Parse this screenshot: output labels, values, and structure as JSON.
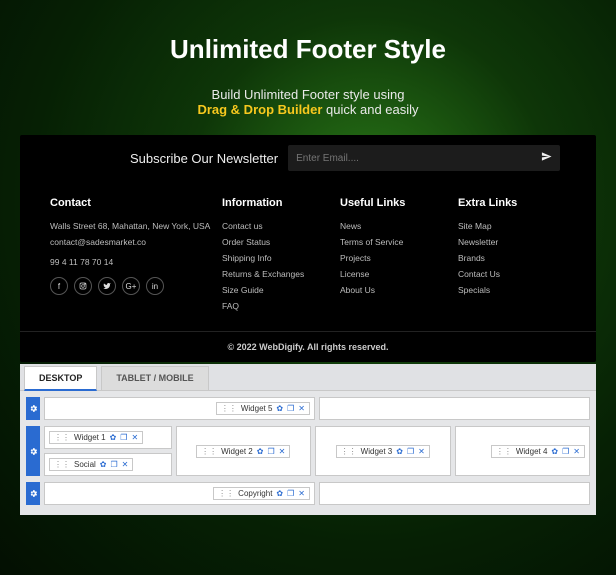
{
  "hero": {
    "title": "Unlimited Footer Style",
    "sub_before": "Build Unlimited Footer style using",
    "sub_accent": "Drag & Drop Builder",
    "sub_after": "quick and easily"
  },
  "newsletter": {
    "label": "Subscribe Our Newsletter",
    "placeholder": "Enter Email...."
  },
  "footer": {
    "contact": {
      "title": "Contact",
      "address": "Walls Street 68, Mahattan, New York, USA",
      "email": "contact@sadesmarket.co",
      "phone": "99 4 11 78 70 14"
    },
    "info": {
      "title": "Information",
      "items": [
        "Contact us",
        "Order Status",
        "Shipping Info",
        "Returns & Exchanges",
        "Size Guide",
        "FAQ"
      ]
    },
    "useful": {
      "title": "Useful Links",
      "items": [
        "News",
        "Terms of Service",
        "Projects",
        "License",
        "About Us"
      ]
    },
    "extra": {
      "title": "Extra Links",
      "items": [
        "Site Map",
        "Newsletter",
        "Brands",
        "Contact Us",
        "Specials"
      ]
    },
    "copyright": "© 2022 WebDigify. All rights reserved."
  },
  "builder": {
    "tabs": {
      "desktop": "DESKTOP",
      "mobile": "TABLET / MOBILE"
    },
    "widgets": {
      "w1": "Widget 1",
      "w2": "Widget 2",
      "w3": "Widget 3",
      "w4": "Widget 4",
      "w5": "Widget 5",
      "social": "Social",
      "copyright": "Copyright"
    }
  }
}
